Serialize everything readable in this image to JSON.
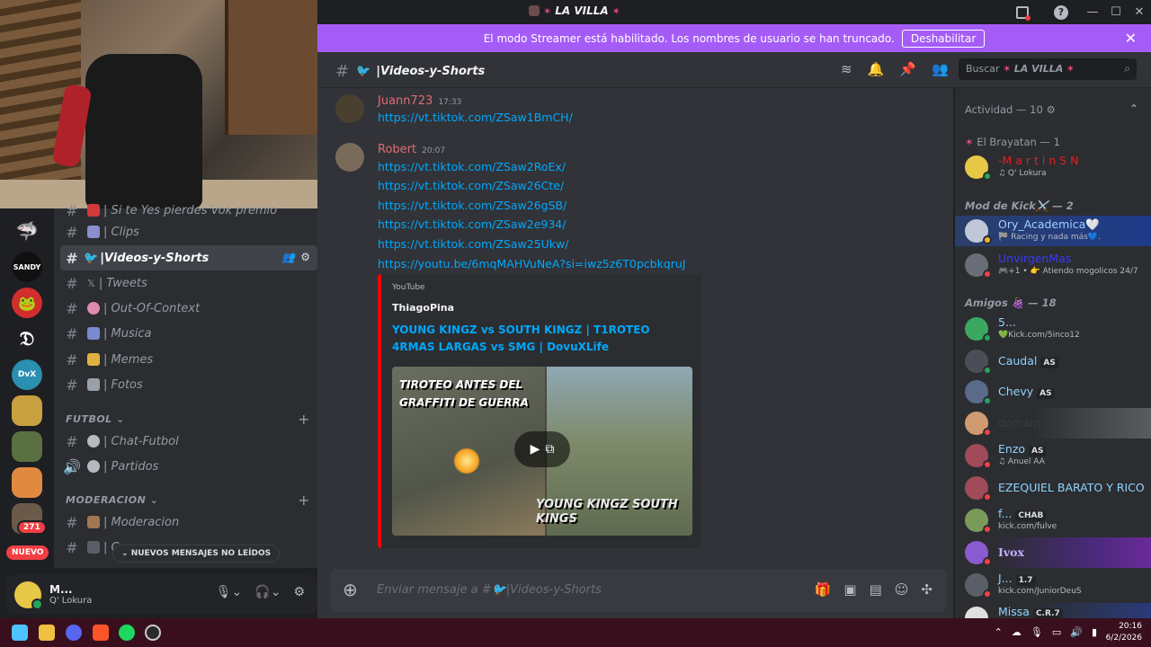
{
  "title": {
    "server_name": "LA VILLA"
  },
  "banner": {
    "text": "El modo Streamer está habilitado. Los nombres de usuario se han truncado.",
    "button": "Deshabilitar",
    "close": "✕"
  },
  "servers": {
    "badge_count": "271",
    "nuevo": "NUEVO",
    "sandy": "SANDY"
  },
  "channels": {
    "partial_top": "| Si te Yes pierdes Vok premio",
    "items": [
      {
        "label": "| Clips"
      },
      {
        "label": "|Videos-y-Shorts"
      },
      {
        "label": "| Tweets"
      },
      {
        "label": "| Out-Of-Context"
      },
      {
        "label": "| Musica"
      },
      {
        "label": "| Memes"
      },
      {
        "label": "| Fotos"
      }
    ],
    "cat_futbol": "FUTBOL",
    "futbol": [
      {
        "label": "| Chat-Futbol"
      },
      {
        "label": "| Partidos"
      }
    ],
    "cat_moderacion": "MODERACION",
    "moderacion": [
      {
        "label": "| Moderacion"
      },
      {
        "label": "| C"
      }
    ],
    "unread_pill": "NUEVOS MENSAJES NO LEÍDOS"
  },
  "user": {
    "name": "M...",
    "status": "Q' Lokura"
  },
  "chat": {
    "channel_title": "|Videos-y-Shorts",
    "search_placeholder": "Buscar",
    "search_server": "LA VILLA",
    "messages": [
      {
        "author": "Juann723",
        "time": "17:33"
      },
      {
        "author": "Robert",
        "time": "20:07"
      }
    ],
    "links": [
      "https://vt.tiktok.com/ZSaw1BmCH/",
      "https://vt.tiktok.com/ZSaw2RoEx/",
      "https://vt.tiktok.com/ZSaw26Cte/",
      "https://vt.tiktok.com/ZSaw26gSB/",
      "https://vt.tiktok.com/ZSaw2e934/",
      "https://vt.tiktok.com/ZSaw25Ukw/",
      "https://youtu.be/6mqMAHVuNeA?si=iwz5z6T0pcbkqruJ"
    ],
    "embed": {
      "provider": "YouTube",
      "author": "ThiagoPina",
      "title": "YOUNG KINGZ vs SOUTH KINGZ  | T1RОTEO 4RMAS LARGAS vs SMG | DovuXLife",
      "thumb_text_1": "TIROTEO ANTES DEL GRAFFITI DE GUERRA",
      "thumb_text_2": "YOUNG KINGZ SOUTH KINGS"
    },
    "composer_placeholder": "Enviar mensaje a #🐦|Videos-y-Shorts"
  },
  "members": {
    "activity_header": "Actividad — 10",
    "groups": [
      {
        "label": "El Brayatan — 1"
      },
      {
        "label": "Mod de Kick⚔️ — 2"
      },
      {
        "label": "Amigos 🍇 — 18"
      }
    ],
    "list": [
      {
        "name": "-M a r t i n S N",
        "sub": "♫ Q' Lokura"
      },
      {
        "name": "Ory_Academica🤍",
        "sub": "🏁 Racing y nada más💙."
      },
      {
        "name": "UnvirgenMas",
        "sub": "🎮+1 • 👉 Atiendo mogolicos 24/7"
      },
      {
        "name": "5...",
        "sub": "💚Kick.com/5inco12"
      },
      {
        "name": "Caudal",
        "sub": "",
        "tag": "AS"
      },
      {
        "name": "Chevy",
        "sub": "",
        "tag": "AS"
      },
      {
        "name": "domain",
        "sub": ""
      },
      {
        "name": "Enzo",
        "sub": "♫ Anuel AA",
        "tag": "AS"
      },
      {
        "name": "EZEQUIEL BARATO Y RICO",
        "sub": ""
      },
      {
        "name": "f...",
        "sub": "kick.com/fulve",
        "tag": "CHAB"
      },
      {
        "name": "Ivox",
        "sub": ""
      },
      {
        "name": "J...",
        "sub": "kick.com/JuniorDeuS",
        "tag": "1.7"
      },
      {
        "name": "Missa",
        "sub": "",
        "tag": "C.R.7"
      }
    ]
  },
  "taskbar": {
    "time": "20:16",
    "date": "6/2/2026"
  },
  "colors": {
    "accent": "#a55cf7",
    "link": "#00a8fc",
    "danger": "#f23f43",
    "online": "#23a55a"
  }
}
